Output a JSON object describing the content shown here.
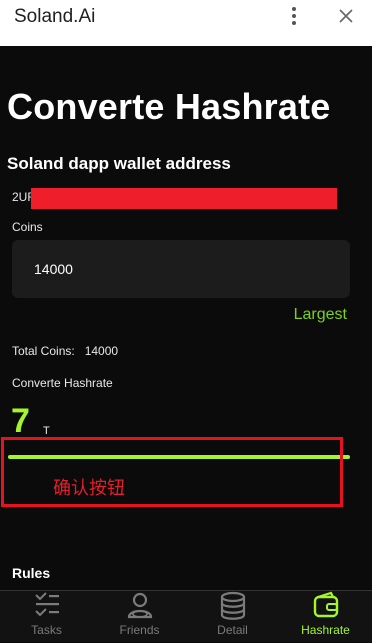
{
  "app": {
    "title": "Soland.Ai"
  },
  "page": {
    "heading": "Converte Hashrate",
    "wallet_label": "Soland dapp wallet address",
    "wallet_prefix": "2UF",
    "coins_label": "Coins",
    "coins_value": "14000",
    "largest_label": "Largest",
    "total_label": "Total Coins:",
    "total_value": "14000",
    "converte_label": "Converte Hashrate",
    "hashrate_value": "7",
    "hashrate_unit": "T",
    "confirm_label": "确认按钮",
    "rules_label": "Rules"
  },
  "nav": {
    "items": [
      {
        "label": "Tasks",
        "icon": "tasks-icon"
      },
      {
        "label": "Friends",
        "icon": "friends-icon"
      },
      {
        "label": "Detail",
        "icon": "database-icon"
      },
      {
        "label": "Hashrate",
        "icon": "wallet-icon"
      }
    ],
    "active": "Hashrate"
  },
  "colors": {
    "accent": "#a6f52b",
    "alert": "#e3141f"
  }
}
